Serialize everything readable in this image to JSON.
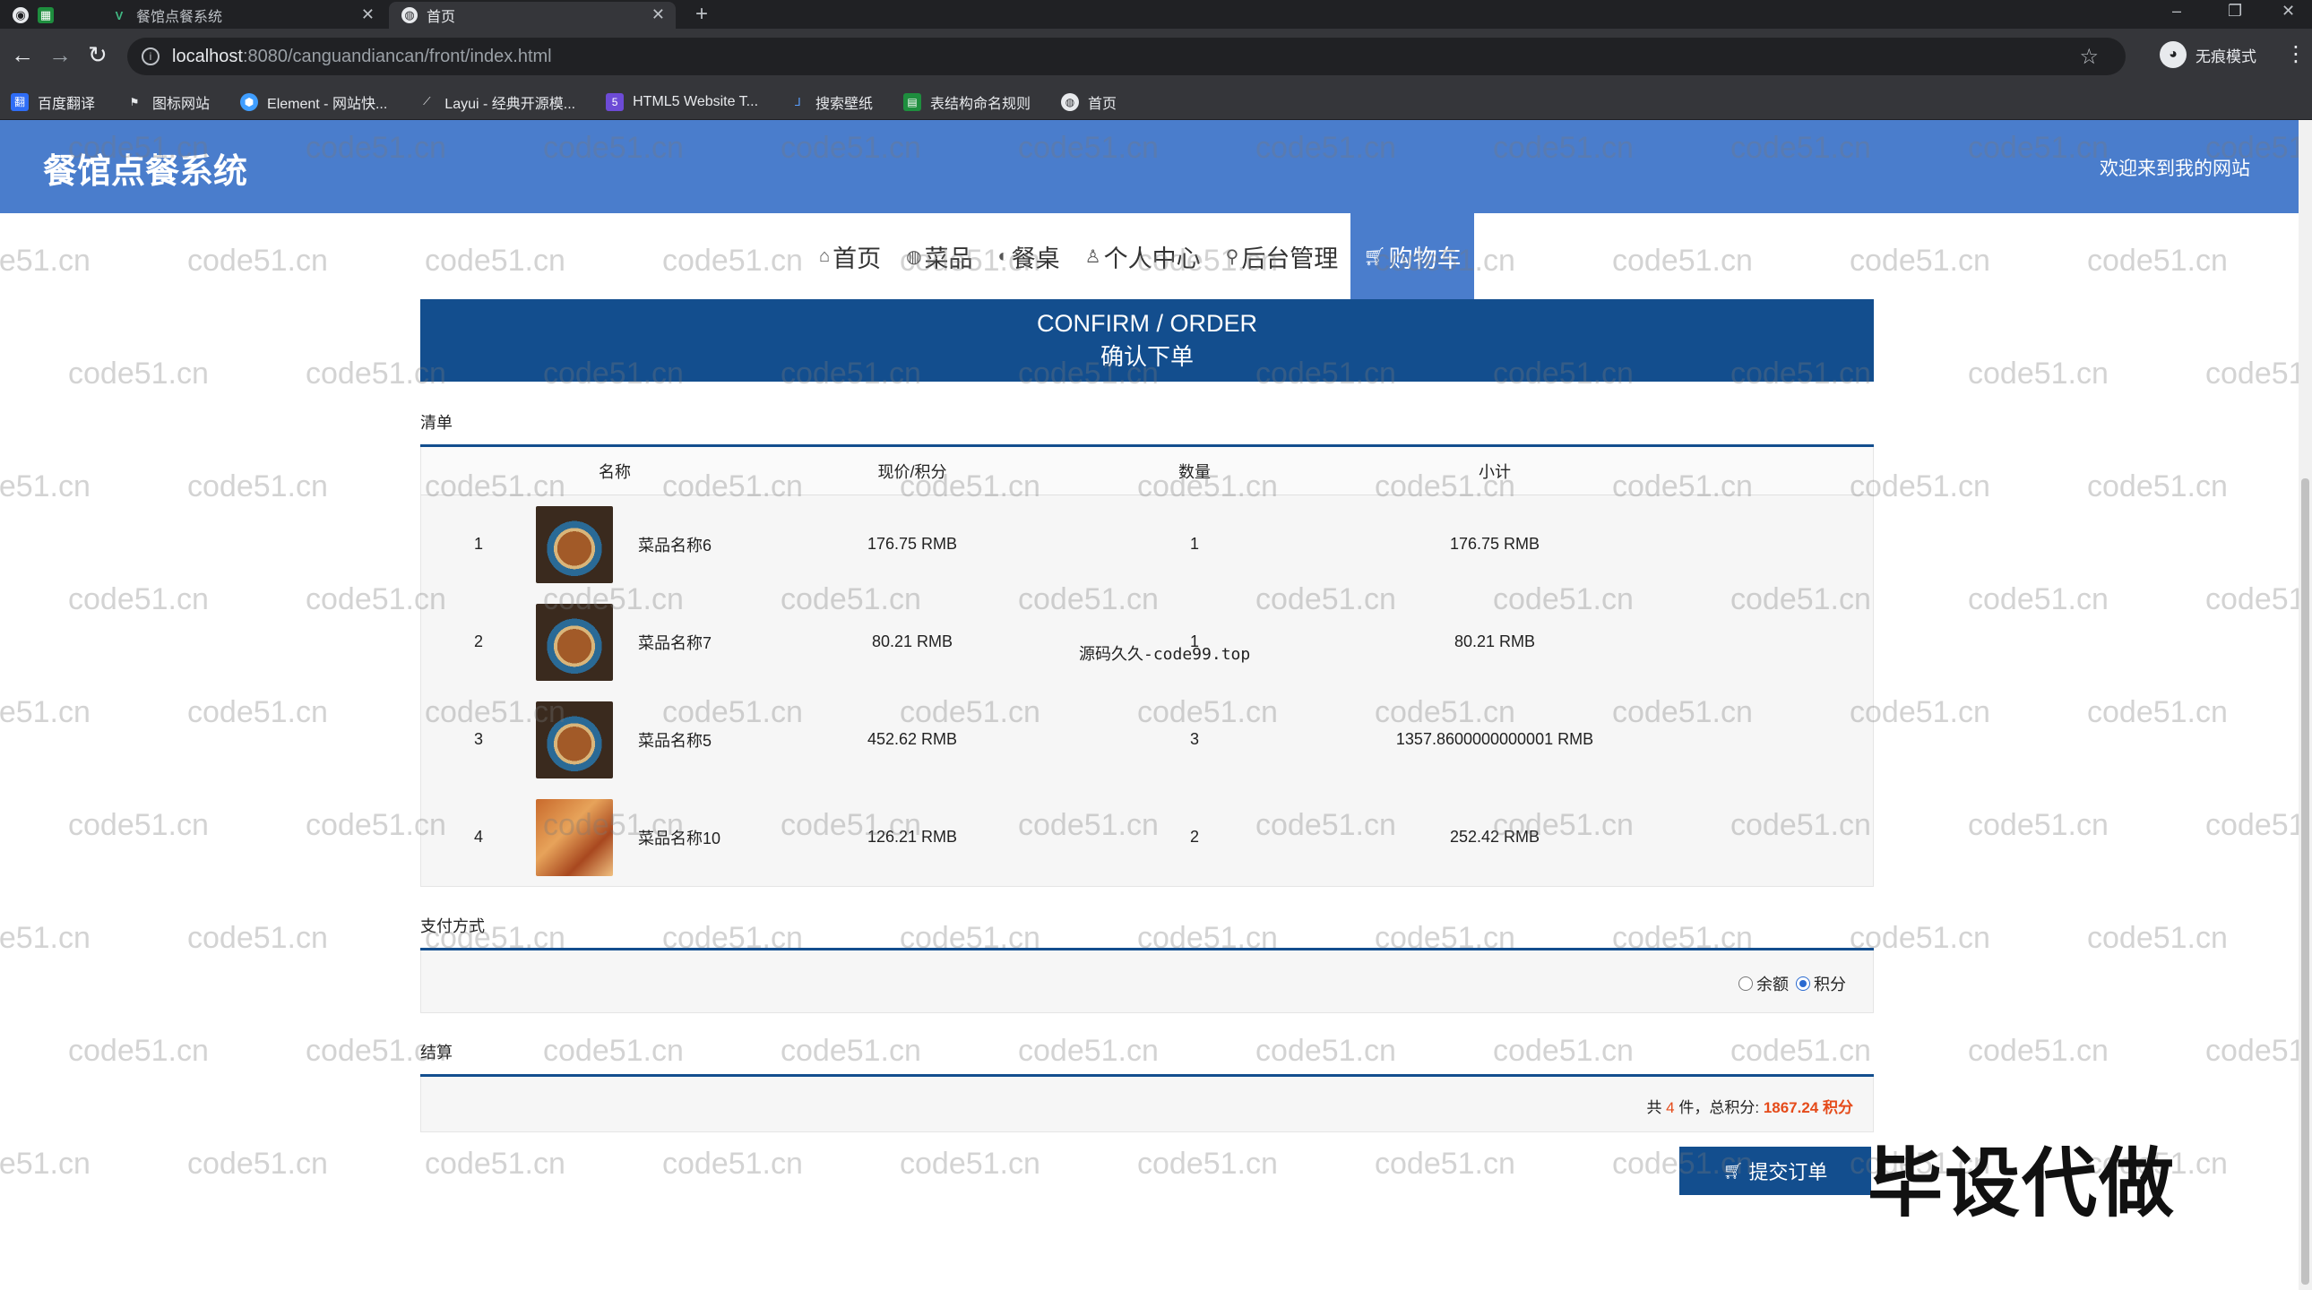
{
  "browser": {
    "tabs": [
      {
        "title": "餐馆点餐系统",
        "active": false
      },
      {
        "title": "首页",
        "active": true
      }
    ],
    "url_host": "localhost",
    "url_path": ":8080/canguandiancan/front/index.html",
    "profile_label": "无痕模式",
    "bookmarks": [
      "百度翻译",
      "图标网站",
      "Element - 网站快...",
      "Layui - 经典开源模...",
      "HTML5 Website T...",
      "搜索壁纸",
      "表结构命名规则",
      "首页"
    ]
  },
  "site": {
    "title": "餐馆点餐系统",
    "welcome": "欢迎来到我的网站"
  },
  "nav": {
    "items": [
      {
        "label": "首页",
        "icon": "home-icon"
      },
      {
        "label": "菜品",
        "icon": "globe-icon"
      },
      {
        "label": "餐桌",
        "icon": "palette-icon"
      },
      {
        "label": "个人中心",
        "icon": "user-icon"
      },
      {
        "label": "后台管理",
        "icon": "link-icon"
      },
      {
        "label": "购物车",
        "icon": "cart-icon",
        "active": true
      }
    ]
  },
  "banner": {
    "en": "CONFIRM / ORDER",
    "zh": "确认下单"
  },
  "order": {
    "section_title": "清单",
    "columns": {
      "name": "名称",
      "price": "现价/积分",
      "qty": "数量",
      "subtotal": "小计"
    },
    "rows": [
      {
        "no": "1",
        "name": "菜品名称6",
        "price": "176.75 RMB",
        "qty": "1",
        "subtotal": "176.75 RMB",
        "image": "bowl"
      },
      {
        "no": "2",
        "name": "菜品名称7",
        "price": "80.21 RMB",
        "qty": "1",
        "subtotal": "80.21 RMB",
        "image": "bowl"
      },
      {
        "no": "3",
        "name": "菜品名称5",
        "price": "452.62 RMB",
        "qty": "3",
        "subtotal": "1357.8600000000001 RMB",
        "image": "bowl"
      },
      {
        "no": "4",
        "name": "菜品名称10",
        "price": "126.21 RMB",
        "qty": "2",
        "subtotal": "252.42 RMB",
        "image": "tray"
      }
    ]
  },
  "payment": {
    "section_title": "支付方式",
    "options": [
      {
        "label": "余额",
        "checked": false
      },
      {
        "label": "积分",
        "checked": true
      }
    ]
  },
  "settlement": {
    "section_title": "结算",
    "prefix": "共 ",
    "count": "4",
    "middle": " 件，总积分: ",
    "total": "1867.24 积分"
  },
  "submit_label": "提交订单",
  "overlay": {
    "watermark": "code51.cn",
    "source_note": "源码久久-code99.top",
    "promo": "毕设代做"
  },
  "colors": {
    "header_blue": "#4a7dcc",
    "banner_navy": "#134e8e",
    "accent_orange": "#e54b1a"
  }
}
